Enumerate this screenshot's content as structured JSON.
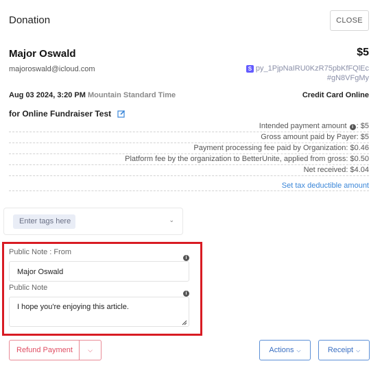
{
  "header": {
    "title": "Donation",
    "close_label": "CLOSE"
  },
  "donor": {
    "name": "Major Oswald",
    "email": "majoroswald@icloud.com",
    "amount": "$5",
    "payment_id_line1": "py_1PjpNaIRU0KzR75pbKfFQlEc",
    "payment_id_line2": "#gN8VFgMy",
    "payment_icon": "stripe-icon",
    "date": "Aug 03 2024, 3:20 PM",
    "timezone": "Mountain Standard Time",
    "method": "Credit Card Online"
  },
  "campaign": {
    "label": "for Online Fundraiser Test",
    "edit_icon": "edit-icon"
  },
  "breakdown": {
    "intended_label": "Intended payment amount",
    "intended_value": ": $5",
    "rows": [
      "Gross amount paid by Payer: $5",
      "Payment processing fee paid by Organization: $0.46",
      "Platform fee by the organization to BetterUnite, applied from gross: $0.50",
      "Net received: $4.04"
    ],
    "tax_link": "Set tax deductible amount"
  },
  "tags": {
    "placeholder": "Enter tags here"
  },
  "public_note": {
    "from_label": "Public Note : From",
    "from_value": "Major Oswald",
    "note_label": "Public Note",
    "note_value": "I hope you're enjoying this article."
  },
  "footer": {
    "refund_label": "Refund Payment",
    "actions_label": "Actions",
    "receipt_label": "Receipt"
  },
  "colors": {
    "accent_blue": "#3a86d8",
    "refund_red": "#e04e63",
    "highlight_red": "#d81b23",
    "stripe_purple": "#635bff"
  }
}
